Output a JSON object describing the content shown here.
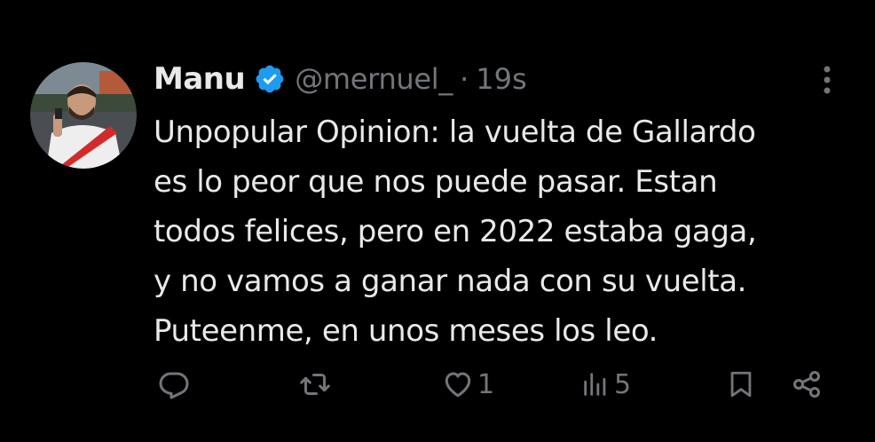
{
  "tweet": {
    "author": {
      "display_name": "Manu",
      "handle": "@mernuel_",
      "verified_icon": "verified-badge-icon",
      "avatar_icon": "avatar"
    },
    "separator": "·",
    "timestamp": "19s",
    "text_lines": [
      "Unpopular Opinion: la vuelta de Gallardo",
      "es lo peor que nos puede pasar. Estan",
      "todos felices, pero en 2022 estaba gaga,",
      "y no vamos a ganar nada con su vuelta.",
      "Puteenme, en unos meses los leo."
    ],
    "actions": {
      "reply": {
        "icon": "reply-icon",
        "count": ""
      },
      "retweet": {
        "icon": "retweet-icon",
        "count": ""
      },
      "like": {
        "icon": "heart-icon",
        "count": "1"
      },
      "views": {
        "icon": "views-icon",
        "count": "5"
      },
      "bookmark": {
        "icon": "bookmark-icon"
      },
      "share": {
        "icon": "share-icon"
      }
    },
    "more_icon": "more-options-icon"
  },
  "colors": {
    "background": "#000000",
    "primary_text": "#e7e9ea",
    "secondary_text": "#71767b",
    "verified_blue": "#1d9bf0"
  }
}
